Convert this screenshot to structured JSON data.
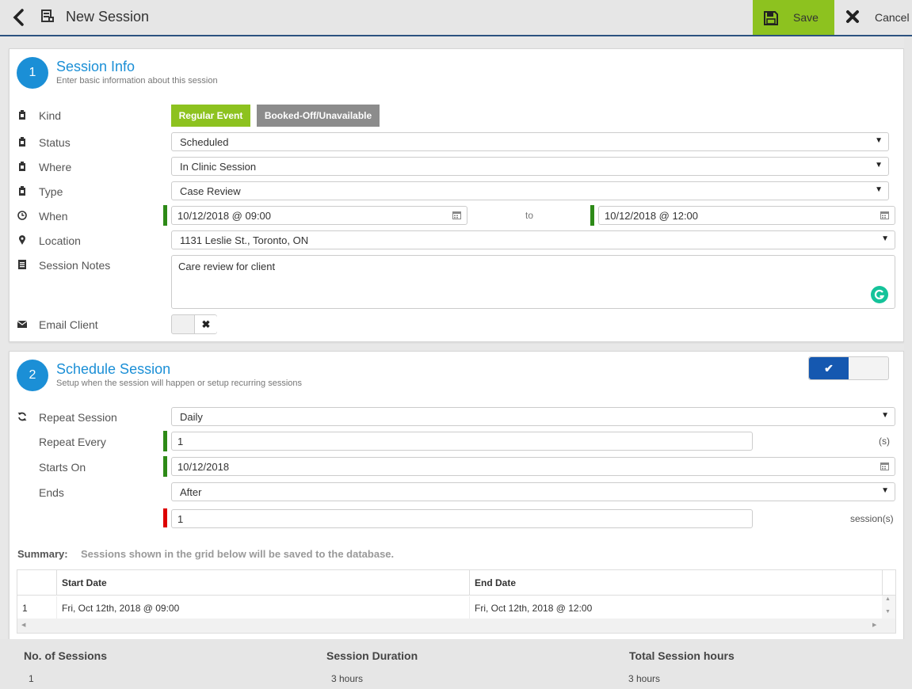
{
  "header": {
    "title": "New Session",
    "save_label": "Save",
    "cancel_label": "Cancel"
  },
  "colors": {
    "accent": "#1b8fd6",
    "save_green": "#8dc21f",
    "kind_green": "#8dc21f",
    "kind_gray": "#8c8c8c",
    "toggle_blue": "#1558b0",
    "required_green": "#2d8a17",
    "required_red": "#dd0000"
  },
  "session_info": {
    "step": "1",
    "title": "Session Info",
    "subtitle": "Enter basic information about this session",
    "kind": {
      "label": "Kind",
      "options": [
        "Regular Event",
        "Booked-Off/Unavailable"
      ],
      "selected": "Regular Event"
    },
    "status": {
      "label": "Status",
      "value": "Scheduled"
    },
    "where": {
      "label": "Where",
      "value": "In Clinic Session"
    },
    "type": {
      "label": "Type",
      "value": "Case Review"
    },
    "when": {
      "label": "When",
      "start": "10/12/2018 @ 09:00",
      "to_label": "to",
      "end": "10/12/2018 @ 12:00"
    },
    "location": {
      "label": "Location",
      "value": "1131 Leslie St., Toronto, ON"
    },
    "notes": {
      "label": "Session Notes",
      "value": "Care review for client"
    },
    "email": {
      "label": "Email Client",
      "enabled": false
    }
  },
  "schedule": {
    "step": "2",
    "title": "Schedule Session",
    "subtitle": "Setup when the session will happen or setup recurring sessions",
    "enabled": true,
    "repeat": {
      "label": "Repeat Session",
      "value": "Daily"
    },
    "repeat_every": {
      "label": "Repeat Every",
      "value": "1",
      "unit": "(s)"
    },
    "starts_on": {
      "label": "Starts On",
      "value": "10/12/2018"
    },
    "ends": {
      "label": "Ends",
      "value": "After",
      "count": "1",
      "unit": "session(s)"
    },
    "summary_label": "Summary:",
    "summary_text": "Sessions shown in the grid below will be saved to the database.",
    "table": {
      "columns": [
        "Start Date",
        "End Date"
      ],
      "rows": [
        {
          "num": "1",
          "start": "Fri, Oct 12th, 2018 @ 09:00",
          "end": "Fri, Oct 12th, 2018 @ 12:00"
        }
      ]
    }
  },
  "footer": {
    "sessions": {
      "label": "No. of Sessions",
      "value": "1"
    },
    "duration": {
      "label": "Session Duration",
      "value": "3 hours"
    },
    "total": {
      "label": "Total Session hours",
      "value": "3 hours"
    }
  }
}
